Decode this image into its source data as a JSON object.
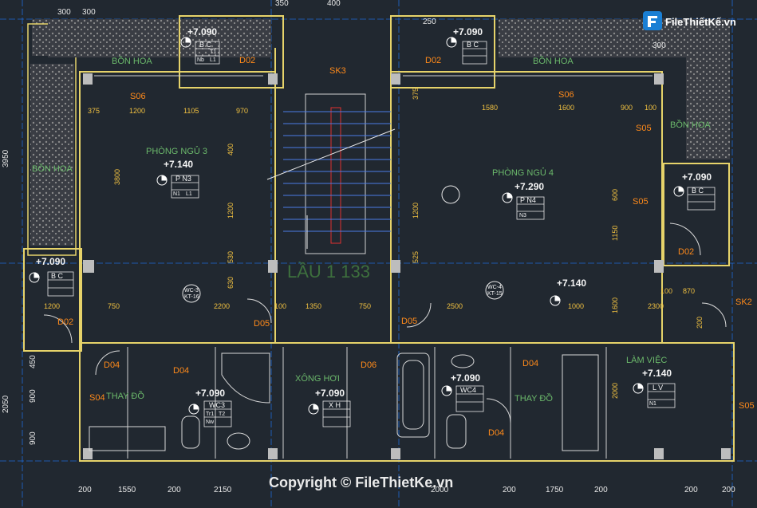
{
  "plan": {
    "floor_label": "LẦU 1 133",
    "rooms": [
      "PHÒNG NGỦ 3",
      "PHÒNG NGỦ 4",
      "BỒN HOA",
      "BỒN HOA",
      "BỒN HOA",
      "BỒN HOA",
      "THAY ĐỒ",
      "THAY ĐỒ",
      "XÔNG HƠI",
      "LÀM VIỆC"
    ],
    "elevations": [
      "+7.090",
      "+7.090",
      "+7.140",
      "+7.290",
      "+7.090",
      "+7.090",
      "+7.140",
      "+7.090",
      "+7.090",
      "+7.090",
      "+7.140"
    ],
    "doors": [
      "D02",
      "D02",
      "D02",
      "D02",
      "D04",
      "D04",
      "D04",
      "D04",
      "D05",
      "D05",
      "D06",
      "S04",
      "S05",
      "S05",
      "S06",
      "S06",
      "SK2",
      "SK3",
      "S05"
    ],
    "tags": [
      "B C",
      "P N3",
      "B C",
      "P N4",
      "B C",
      "WC3",
      "X H",
      "WC4",
      "L V",
      "B C"
    ],
    "legend_codes": [
      "T1",
      "Nb",
      "L1",
      "Tr1",
      "N1",
      "L1",
      "N3",
      "Nw",
      "T2",
      "N1"
    ],
    "section_marks": [
      "WC-3",
      "KT-16",
      "WC-4",
      "KT-15"
    ],
    "dims_top": [
      "300",
      "300",
      "350",
      "400",
      "300",
      "250"
    ],
    "dims_bottom": [
      "200",
      "1550",
      "200",
      "2150",
      "2000",
      "200",
      "1750",
      "200",
      "200",
      "200"
    ],
    "dims_misc": [
      "375",
      "1200",
      "1105",
      "970",
      "1580",
      "1600",
      "900",
      "100",
      "1200",
      "750",
      "2200",
      "100",
      "1350",
      "750",
      "2500",
      "1000",
      "2300",
      "870",
      "100",
      "3800",
      "600",
      "1150",
      "530",
      "525",
      "630",
      "1200",
      "1200",
      "400",
      "375",
      "450",
      "3950",
      "2050",
      "900",
      "900",
      "1600",
      "2000",
      "200"
    ],
    "watermark": "Copyright © FileThietKe.vn",
    "logo_text": "FileThiếtKế.vn"
  }
}
